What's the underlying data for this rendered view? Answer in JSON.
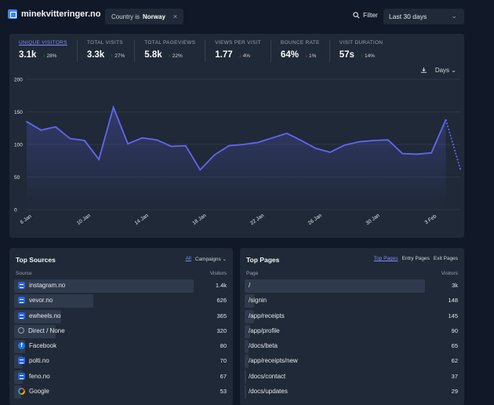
{
  "header": {
    "site": "minekvitteringer.no",
    "filter_prefix": "Country is",
    "filter_value": "Norway",
    "filter_label": "Filter",
    "date_range": "Last 30 days"
  },
  "stats": [
    {
      "label": "Unique visitors",
      "value": "3.1k",
      "change": "28%",
      "dir": "up",
      "active": true
    },
    {
      "label": "Total visits",
      "value": "3.3k",
      "change": "27%",
      "dir": "up",
      "active": false
    },
    {
      "label": "Total pageviews",
      "value": "5.8k",
      "change": "22%",
      "dir": "up",
      "active": false
    },
    {
      "label": "Views per visit",
      "value": "1.77",
      "change": "4%",
      "dir": "down",
      "active": false
    },
    {
      "label": "Bounce rate",
      "value": "64%",
      "change": "1%",
      "dir": "down",
      "active": false
    },
    {
      "label": "Visit duration",
      "value": "57s",
      "change": "14%",
      "dir": "up",
      "active": false
    }
  ],
  "chart_controls": {
    "interval": "Days"
  },
  "chart_data": {
    "type": "line",
    "x": [
      "6 Jan",
      "7 Jan",
      "8 Jan",
      "9 Jan",
      "10 Jan",
      "11 Jan",
      "12 Jan",
      "13 Jan",
      "14 Jan",
      "15 Jan",
      "16 Jan",
      "17 Jan",
      "18 Jan",
      "19 Jan",
      "20 Jan",
      "21 Jan",
      "22 Jan",
      "23 Jan",
      "24 Jan",
      "25 Jan",
      "26 Jan",
      "27 Jan",
      "28 Jan",
      "29 Jan",
      "30 Jan",
      "31 Jan",
      "1 Feb",
      "2 Feb",
      "3 Feb",
      "4 Feb",
      "5 Feb"
    ],
    "values": [
      135,
      122,
      127,
      109,
      106,
      77,
      157,
      101,
      110,
      107,
      97,
      98,
      61,
      84,
      98,
      100,
      103,
      110,
      117,
      106,
      94,
      88,
      99,
      104,
      106,
      107,
      86,
      85,
      87,
      138,
      62
    ],
    "tick_labels": [
      "6 Jan",
      "10 Jan",
      "14 Jan",
      "18 Jan",
      "22 Jan",
      "26 Jan",
      "30 Jan",
      "3 Feb"
    ],
    "ylim": [
      0,
      200
    ],
    "yticks": [
      0,
      50,
      100,
      150,
      200
    ],
    "grid": true,
    "line_color": "#6366f1"
  },
  "sources": {
    "title": "Top Sources",
    "tabs": [
      "All",
      "Campaigns"
    ],
    "col_left": "Source",
    "col_right": "Visitors",
    "items": [
      {
        "name": "instagram.no",
        "count": "1.4k",
        "icon": "web",
        "frac": 1.0
      },
      {
        "name": "vevor.no",
        "count": "626",
        "icon": "web",
        "frac": 0.44
      },
      {
        "name": "ewheels.no",
        "count": "365",
        "icon": "web",
        "frac": 0.26
      },
      {
        "name": "Direct / None",
        "count": "320",
        "icon": "link",
        "frac": 0.23
      },
      {
        "name": "Facebook",
        "count": "80",
        "icon": "fb",
        "frac": 0.06
      },
      {
        "name": "polti.no",
        "count": "70",
        "icon": "web",
        "frac": 0.05
      },
      {
        "name": "feno.no",
        "count": "67",
        "icon": "web",
        "frac": 0.05
      },
      {
        "name": "Google",
        "count": "53",
        "icon": "g",
        "frac": 0.04
      }
    ]
  },
  "pages": {
    "title": "Top Pages",
    "tabs": [
      "Top Pages",
      "Entry Pages",
      "Exit Pages"
    ],
    "col_left": "Page",
    "col_right": "Visitors",
    "items": [
      {
        "name": "/",
        "count": "3k",
        "frac": 1.0
      },
      {
        "name": "/signin",
        "count": "148",
        "frac": 0.05
      },
      {
        "name": "/app/receipts",
        "count": "145",
        "frac": 0.05
      },
      {
        "name": "/app/profile",
        "count": "90",
        "frac": 0.03
      },
      {
        "name": "/docs/beta",
        "count": "65",
        "frac": 0.02
      },
      {
        "name": "/app/receipts/new",
        "count": "62",
        "frac": 0.02
      },
      {
        "name": "/docs/contact",
        "count": "37",
        "frac": 0.01
      },
      {
        "name": "/docs/updates",
        "count": "29",
        "frac": 0.01
      }
    ]
  }
}
